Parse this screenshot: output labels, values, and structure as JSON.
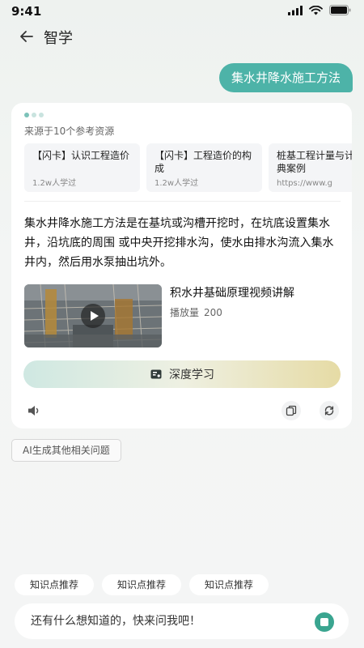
{
  "status_bar": {
    "time": "9:41"
  },
  "nav": {
    "title": "智学",
    "back_icon": "arrow-left-icon"
  },
  "user_message": "集水井降水施工方法",
  "answer_card": {
    "sources_label": "来源于10个参考资源",
    "sources": [
      {
        "title": "【闪卡】认识工程造价",
        "meta": "1.2w人学过"
      },
      {
        "title": "【闪卡】工程造价的构成",
        "meta": "1.2w人学过"
      },
      {
        "title": "桩基工程计量与计价经典案例",
        "meta": "https://www.g"
      }
    ],
    "answer_text": "集水井降水施工方法是在基坑或沟槽开挖时，在坑底设置集水井，沿坑底的周围 或中央开挖排水沟，使水由排水沟流入集水井内，然后用水泵抽出坑外。",
    "video": {
      "title": "积水井基础原理视频讲解",
      "plays_label": "播放量",
      "plays": "200"
    },
    "deep_learn_label": "深度学习",
    "icons": [
      "speaker-icon",
      "copy-icon",
      "refresh-icon",
      "book-icon",
      "play-icon"
    ]
  },
  "ai_more_label": "AI生成其他相关问题",
  "chips": [
    "知识点推荐",
    "知识点推荐",
    "知识点推荐"
  ],
  "input": {
    "placeholder": "还有什么想知道的，快来问我吧！"
  },
  "colors": {
    "accent": "#4db3a8",
    "send": "#3aa590",
    "gold": "#e6dba5"
  }
}
